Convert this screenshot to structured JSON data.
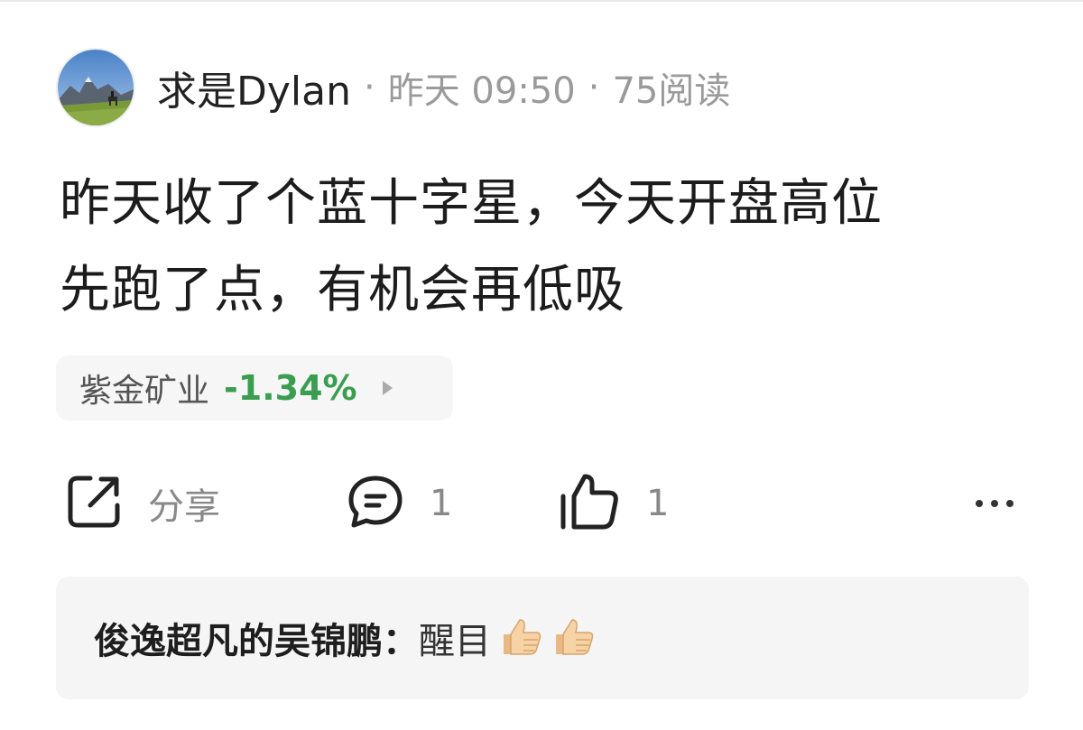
{
  "post": {
    "author": "求是Dylan",
    "separator": "·",
    "time": "昨天 09:50",
    "reads": "75阅读",
    "body_line1": "昨天收了个蓝十字星，今天开盘高位",
    "body_line2": "先跑了点，有机会再低吸"
  },
  "stock": {
    "name": "紫金矿业",
    "change": "-1.34%",
    "change_color": "#3a9d4f"
  },
  "actions": {
    "share_label": "分享",
    "share_icon": "share-icon",
    "comment_count": "1",
    "comment_icon": "comment-icon",
    "like_count": "1",
    "like_icon": "thumbs-up-icon",
    "more_icon": "more-icon"
  },
  "comment": {
    "author": "俊逸超凡的吴锦鹏：",
    "text": "醒目",
    "emoji": "thumbs-up-emoji"
  }
}
